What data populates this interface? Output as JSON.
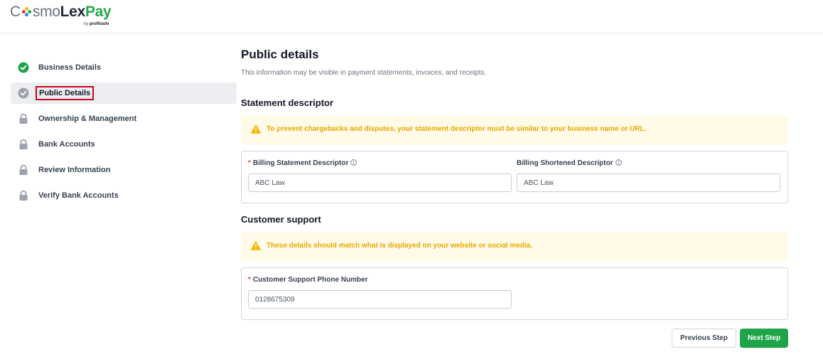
{
  "header": {
    "logo_c": "C",
    "logo_smo": "smo",
    "logo_lex": "Lex",
    "logo_pay": "Pay",
    "logo_by": "by",
    "logo_brand": "profitsolv"
  },
  "sidebar": {
    "steps": [
      {
        "label": "Business Details",
        "status": "complete"
      },
      {
        "label": "Public Details",
        "status": "current"
      },
      {
        "label": "Ownership & Management",
        "status": "locked"
      },
      {
        "label": "Bank Accounts",
        "status": "locked"
      },
      {
        "label": "Review Information",
        "status": "locked"
      },
      {
        "label": "Verify Bank Accounts",
        "status": "locked"
      }
    ]
  },
  "page": {
    "title": "Public details",
    "subtitle": "This information may be visible in payment statements, invoices, and receipts."
  },
  "statement": {
    "title": "Statement descriptor",
    "alert": "To prevent chargebacks and disputes, your statement descriptor must be similar to your business name or URL.",
    "billing_label": "Billing Statement Descriptor",
    "billing_value": "ABC Law",
    "shortened_label": "Billing Shortened Descriptor",
    "shortened_value": "ABC Law"
  },
  "support": {
    "title": "Customer support",
    "alert": "These details should match what is displayed on your website or social media.",
    "phone_label": "Customer Support Phone Number",
    "phone_value": "0128675309"
  },
  "footer": {
    "prev_label": "Previous Step",
    "next_label": "Next Step"
  },
  "colors": {
    "brand_green": "#1fa44a",
    "warning_text": "#e8a800",
    "warning_bg": "#fffbe8",
    "required": "#ef4444",
    "highlight_box": "#d0021b"
  }
}
